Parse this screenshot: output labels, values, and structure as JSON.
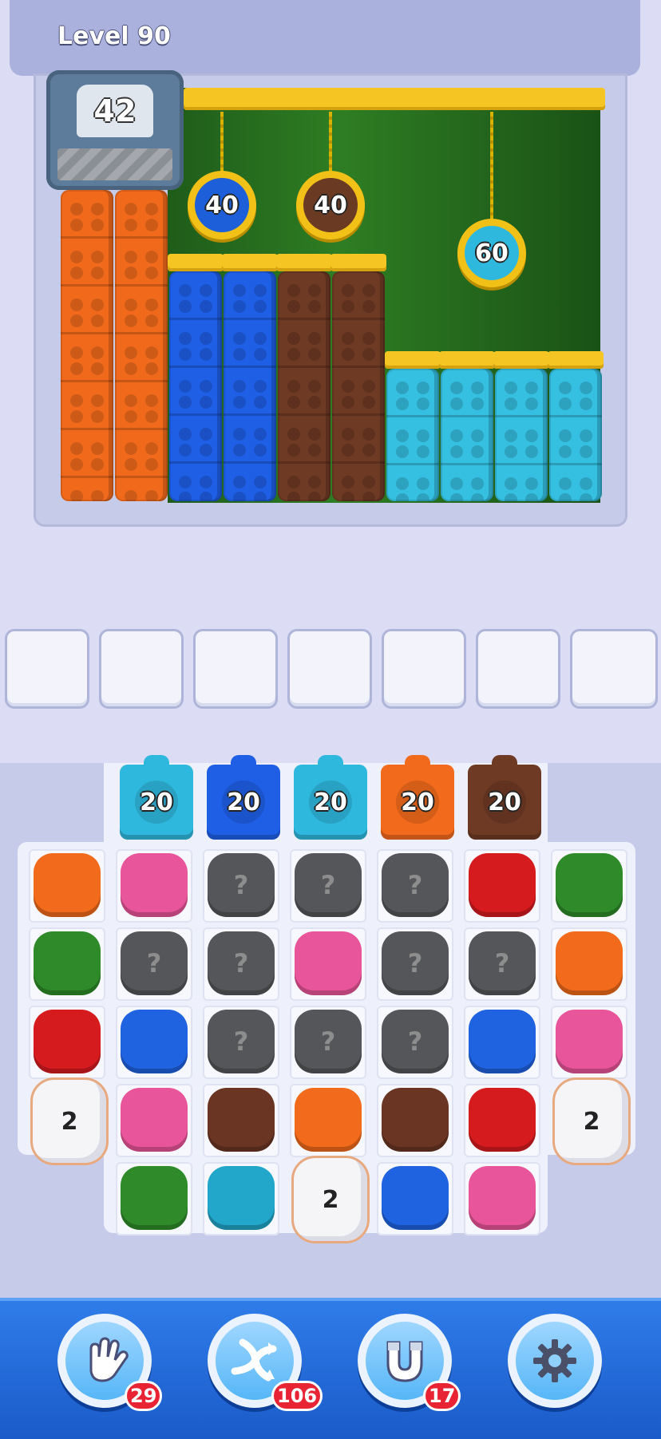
{
  "header": {
    "level_label": "Level 90"
  },
  "dispenser": {
    "count": "42"
  },
  "locks": [
    {
      "value": "40",
      "color": "#1c5fd8"
    },
    {
      "value": "40",
      "color": "#6b3a23"
    },
    {
      "value": "60",
      "color": "#2fb8dd"
    }
  ],
  "brick_columns": [
    {
      "color": "orange",
      "hex": "#f16a1c"
    },
    {
      "color": "orange",
      "hex": "#f16a1c"
    },
    {
      "color": "blue",
      "hex": "#1f5fe6"
    },
    {
      "color": "blue",
      "hex": "#1f5fe6"
    },
    {
      "color": "brown",
      "hex": "#6e3a24"
    },
    {
      "color": "brown",
      "hex": "#6e3a24"
    },
    {
      "color": "cyan",
      "hex": "#35bfe0"
    },
    {
      "color": "cyan",
      "hex": "#35bfe0"
    },
    {
      "color": "cyan",
      "hex": "#35bfe0"
    },
    {
      "color": "cyan",
      "hex": "#35bfe0"
    }
  ],
  "launchers": [
    {
      "count": "20",
      "color": "#2fb8dd"
    },
    {
      "count": "20",
      "color": "#1f5fe6"
    },
    {
      "count": "20",
      "color": "#2fb8dd"
    },
    {
      "count": "20",
      "color": "#f26a1c"
    },
    {
      "count": "20",
      "color": "#6e3a24"
    }
  ],
  "grid": {
    "rows": [
      [
        "orange",
        "pink",
        "hidden",
        "hidden",
        "hidden",
        "red",
        "green"
      ],
      [
        "green",
        "hidden",
        "hidden",
        "pink",
        "hidden",
        "hidden",
        "orange"
      ],
      [
        "red",
        "blue",
        "hidden",
        "hidden",
        "hidden",
        "blue",
        "pink"
      ],
      [
        "pipe",
        "pink",
        "brown",
        "orange",
        "brown",
        "red",
        "pipe"
      ],
      [
        "",
        "green",
        "cyan",
        "pipe",
        "blue",
        "pink",
        ""
      ]
    ],
    "hidden_symbol": "?"
  },
  "pipes": [
    {
      "count": "2"
    },
    {
      "count": "2"
    },
    {
      "count": "2"
    }
  ],
  "tile_colors": {
    "orange": "#f26a1c",
    "pink": "#e9559a",
    "hidden": "#555659",
    "red": "#d61b1f",
    "green": "#2f8b2a",
    "blue": "#1f63e0",
    "brown": "#6b3523",
    "cyan": "#22a6c9"
  },
  "toolbar": {
    "items": [
      {
        "icon": "glove-icon",
        "badge": "29"
      },
      {
        "icon": "shuffle-icon",
        "badge": "106"
      },
      {
        "icon": "magnet-icon",
        "badge": "17"
      },
      {
        "icon": "gear-icon",
        "badge": ""
      }
    ]
  }
}
